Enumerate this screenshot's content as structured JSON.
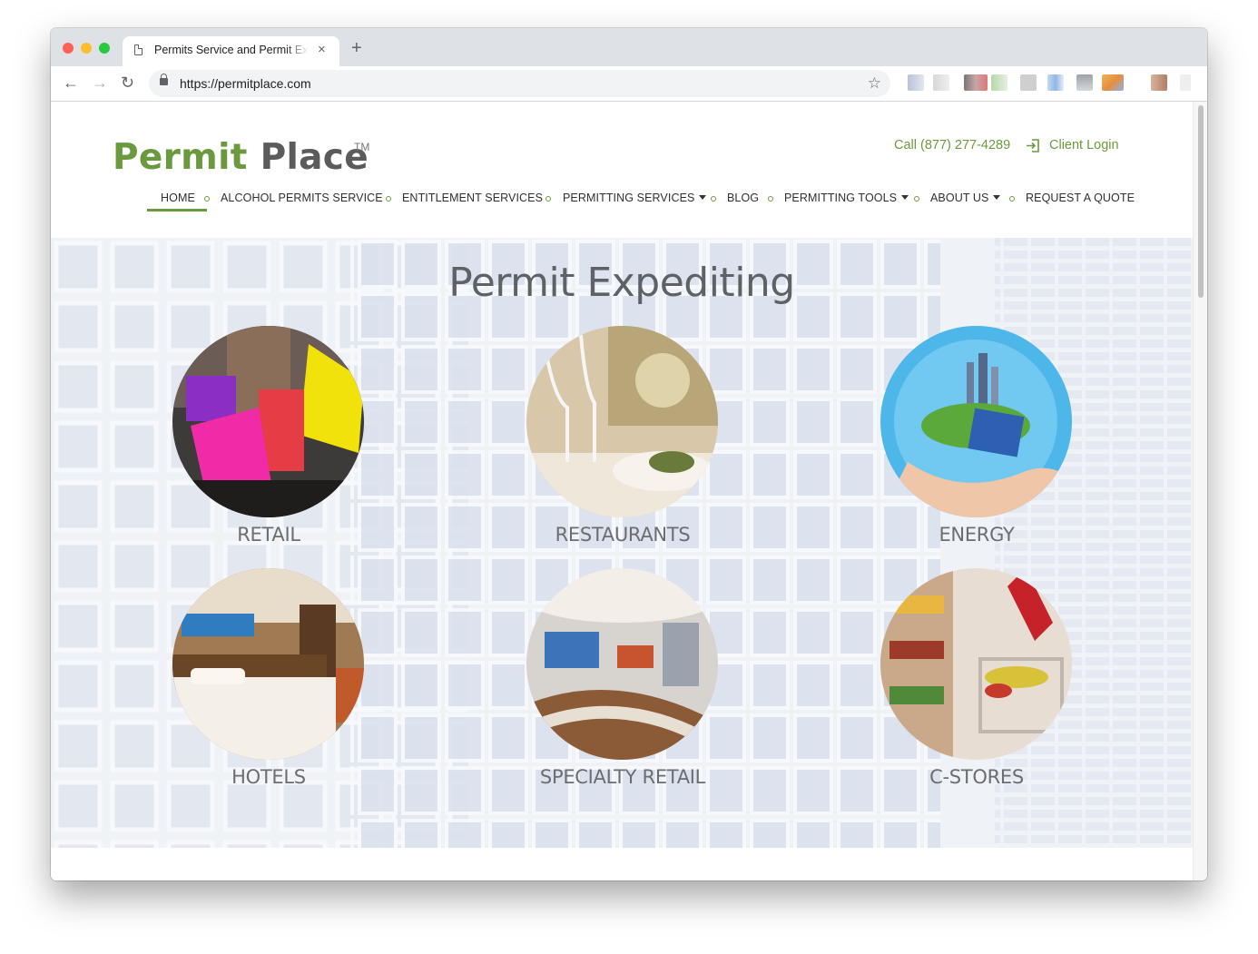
{
  "browser": {
    "tab_title": "Permits Service and Permit Exp",
    "tab_close": "×",
    "new_tab": "+",
    "url": "https://permitplace.com",
    "back_icon": "←",
    "forward_icon": "→",
    "reload_icon": "↻",
    "star_icon": "☆"
  },
  "site": {
    "logo_word1": "Permit",
    "logo_word2": "Place",
    "logo_tm": "TM",
    "phone": "Call (877) 277-4289",
    "client_login": "Client Login",
    "brand_color": "#6a9a3d"
  },
  "nav": {
    "items": [
      {
        "label": "HOME"
      },
      {
        "label": "ALCOHOL PERMITS SERVICE"
      },
      {
        "label": "ENTITLEMENT SERVICES"
      },
      {
        "label": "PERMITTING SERVICES"
      },
      {
        "label": "BLOG"
      },
      {
        "label": "PERMITTING TOOLS"
      },
      {
        "label": "ABOUT US"
      },
      {
        "label": "REQUEST A QUOTE"
      }
    ]
  },
  "hero": {
    "title": "Permit Expediting",
    "cards": [
      {
        "label": "RETAIL"
      },
      {
        "label": "RESTAURANTS"
      },
      {
        "label": "ENERGY"
      },
      {
        "label": "HOTELS"
      },
      {
        "label": "SPECIALTY RETAIL"
      },
      {
        "label": "C-STORES"
      }
    ]
  }
}
